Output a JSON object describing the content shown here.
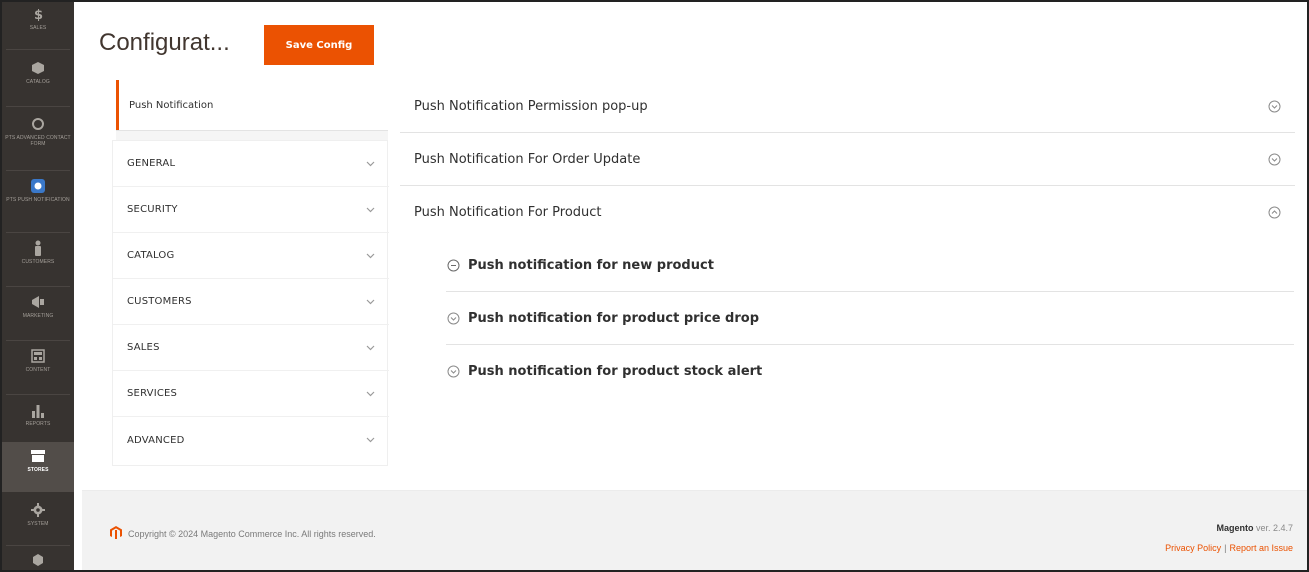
{
  "nav": {
    "items": [
      {
        "label": "SALES",
        "icon": "dollar-icon"
      },
      {
        "label": "CATALOG",
        "icon": "cube-icon"
      },
      {
        "label": "PTS ADVANCED CONTACT FORM",
        "icon": "ring-icon"
      },
      {
        "label": "PTS PUSH NOTIFICATION",
        "icon": "bell-icon"
      },
      {
        "label": "CUSTOMERS",
        "icon": "person-icon"
      },
      {
        "label": "MARKETING",
        "icon": "megaphone-icon"
      },
      {
        "label": "CONTENT",
        "icon": "layout-icon"
      },
      {
        "label": "REPORTS",
        "icon": "bar-chart-icon"
      },
      {
        "label": "STORES",
        "icon": "store-icon"
      },
      {
        "label": "SYSTEM",
        "icon": "gear-icon"
      }
    ],
    "active_index": 8
  },
  "header": {
    "title": "Configurat...",
    "save_label": "Save Config"
  },
  "tabs": {
    "active_tab": "Push Notification",
    "sections": [
      "GENERAL",
      "SECURITY",
      "CATALOG",
      "CUSTOMERS",
      "SALES",
      "SERVICES",
      "ADVANCED"
    ]
  },
  "main": {
    "groups": [
      "Push Notification Permission pop-up",
      "Push Notification For Order Update",
      "Push Notification For Product"
    ],
    "subgroups": [
      "Push notification for new product",
      "Push notification for product price drop",
      "Push notification for product stock alert"
    ]
  },
  "footer": {
    "copyright": "Copyright © 2024 Magento Commerce Inc. All rights reserved.",
    "brand": "Magento",
    "version": "ver. 2.4.7",
    "privacy": "Privacy Policy",
    "separator": "|",
    "report": "Report an Issue"
  },
  "colors": {
    "accent": "#eb5202",
    "nav_bg": "#373330"
  }
}
